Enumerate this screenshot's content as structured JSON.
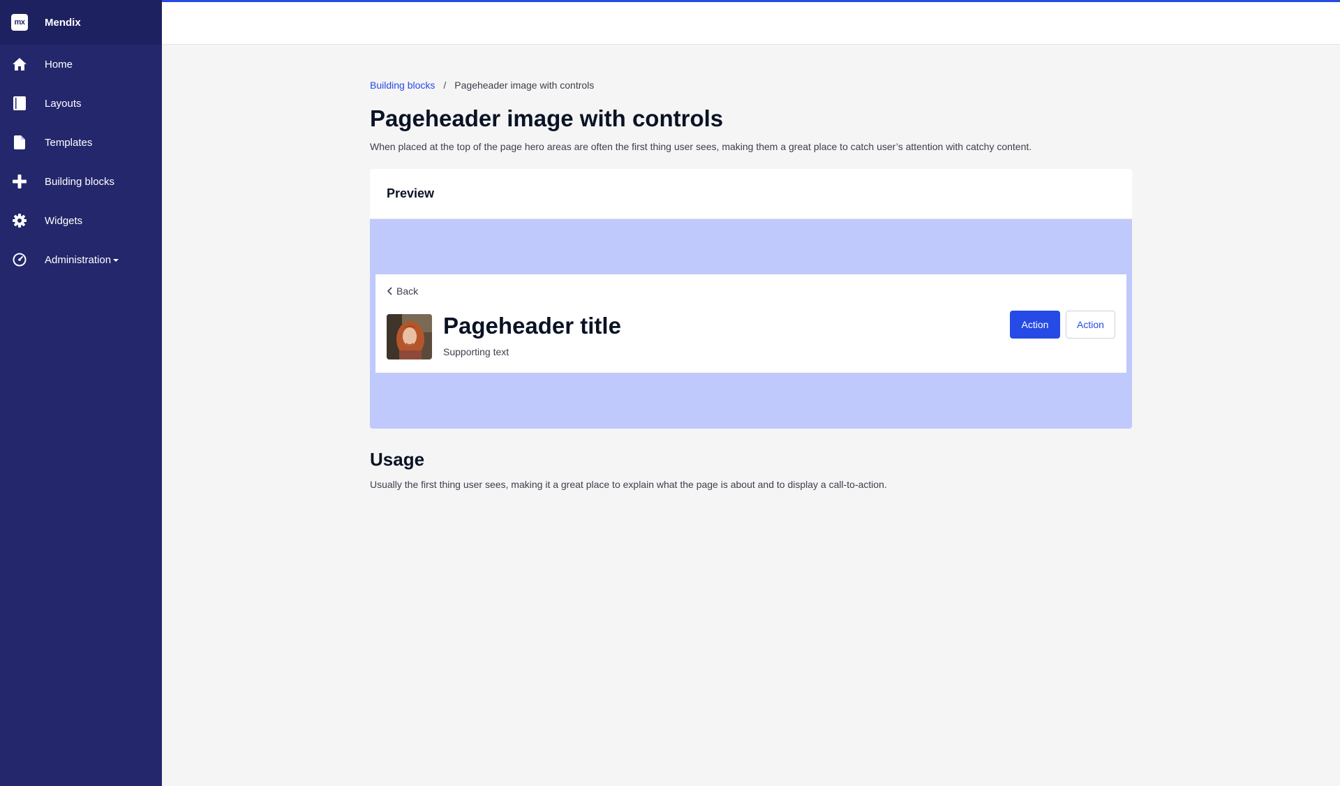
{
  "brand": {
    "logo_text": "mx",
    "name": "Mendix"
  },
  "sidebar": {
    "items": [
      {
        "label": "Home",
        "icon": "home-icon"
      },
      {
        "label": "Layouts",
        "icon": "book-icon"
      },
      {
        "label": "Templates",
        "icon": "file-icon"
      },
      {
        "label": "Building blocks",
        "icon": "plus-icon"
      },
      {
        "label": "Widgets",
        "icon": "gear-icon"
      },
      {
        "label": "Administration",
        "icon": "dashboard-icon"
      }
    ]
  },
  "breadcrumb": {
    "parent": "Building blocks",
    "separator": "/",
    "current": "Pageheader image with controls"
  },
  "page": {
    "title": "Pageheader image with controls",
    "description": "When placed at the top of the page hero areas are often the first thing user sees, making them a great place to catch user’s attention with catchy content."
  },
  "preview": {
    "heading": "Preview",
    "pageheader": {
      "back_label": "Back",
      "title": "Pageheader title",
      "subtitle": "Supporting text",
      "primary_action": "Action",
      "secondary_action": "Action"
    }
  },
  "usage": {
    "title": "Usage",
    "description": "Usually the first thing user sees, making it a great place to explain what the page is about and to display a call-to-action."
  },
  "colors": {
    "sidebar": "#24276c",
    "brand_bar": "#1e2160",
    "accent": "#264ae5",
    "preview_bg": "#bfc9fb",
    "page_bg": "#f5f5f5"
  }
}
